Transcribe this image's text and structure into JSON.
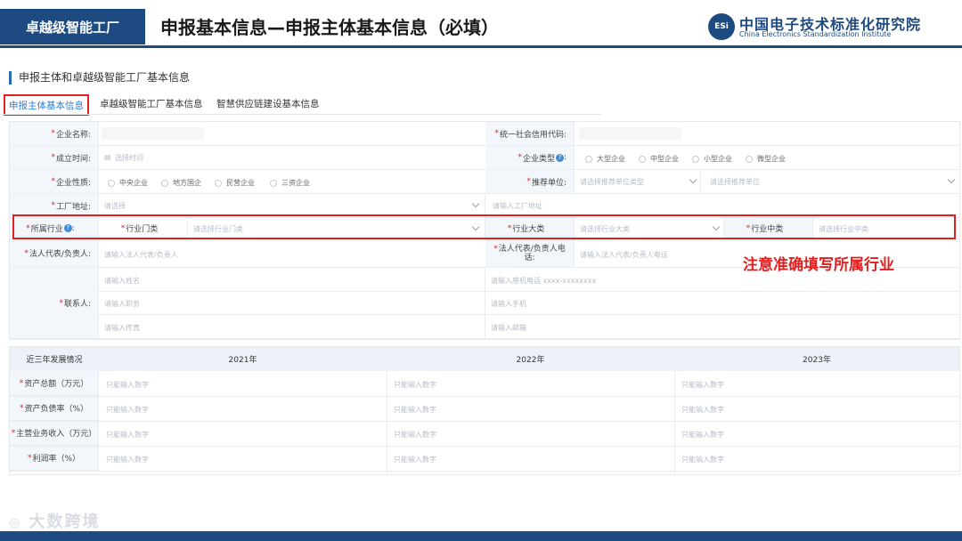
{
  "header": {
    "tag": "卓越级智能工厂",
    "title": "申报基本信息—申报主体基本信息（必填）",
    "logo_cn": "中国电子技术标准化研究院",
    "logo_en": "China Electronics Standardization Institute",
    "logo_mark": "ESi"
  },
  "section_title": "申报主体和卓越级智能工厂基本信息",
  "tabs": [
    {
      "label": "申报主体基本信息",
      "active": true
    },
    {
      "label": "卓越级智能工厂基本信息",
      "active": false
    },
    {
      "label": "智慧供应链建设基本信息",
      "active": false
    }
  ],
  "form": {
    "company_name": {
      "label": "企业名称:",
      "required": "*",
      "value": ""
    },
    "credit_code": {
      "label": "统一社会信用代码:",
      "required": "*",
      "value": ""
    },
    "established": {
      "label": "成立时间:",
      "required": "*",
      "placeholder": "选择时间"
    },
    "company_type": {
      "label": "企业类型",
      "required": "*",
      "options": [
        "大型企业",
        "中型企业",
        "小型企业",
        "微型企业"
      ]
    },
    "company_nature": {
      "label": "企业性质:",
      "required": "*",
      "options": [
        "中央企业",
        "地方国企",
        "民营企业",
        "三资企业"
      ]
    },
    "recommender": {
      "label": "推荐单位:",
      "required": "*",
      "type_placeholder": "请选择推荐单位类型",
      "unit_placeholder": "请选择推荐单位"
    },
    "address": {
      "label": "工厂地址:",
      "required": "*",
      "select_placeholder": "请选择",
      "input_placeholder": "请输入工厂地址"
    },
    "industry": {
      "label": "所属行业",
      "required": "*",
      "door_label": "行业门类",
      "door_placeholder": "请选择行业门类",
      "major_label": "行业大类",
      "major_placeholder": "请选择行业大类",
      "mid_label": "行业中类",
      "mid_placeholder": "请选择行业中类"
    },
    "legal_rep": {
      "label": "法人代表/负责人:",
      "required": "*",
      "placeholder": "请输入法人代表/负责人"
    },
    "legal_phone": {
      "label": "法人代表/负责人电话:",
      "required": "*",
      "placeholder": "请输入法人代表/负责人电话"
    },
    "contact": {
      "label": "联系人:",
      "required": "*",
      "name_placeholder": "请输入姓名",
      "landline_placeholder": "请输入座机电话 xxxx-xxxxxxxx",
      "position_placeholder": "请输入职务",
      "mobile_placeholder": "请输入手机",
      "fax_placeholder": "请输入传真",
      "email_placeholder": "请输入邮箱"
    }
  },
  "note": "注意准确填写所属行业",
  "dev_table": {
    "header": "近三年发展情况",
    "years": [
      "2021年",
      "2022年",
      "2023年"
    ],
    "rows": [
      {
        "label": "资产总额（万元）",
        "required": "*"
      },
      {
        "label": "资产负债率（%）",
        "required": "*"
      },
      {
        "label": "主营业务收入（万元）",
        "required": "*"
      },
      {
        "label": "利润率（%）",
        "required": "*"
      }
    ],
    "cell_placeholder": "只能输入数字"
  },
  "watermark": "大数跨境",
  "colors": {
    "brand": "#1d4a80",
    "accent": "#2a7bd6",
    "highlight": "#e02020"
  }
}
